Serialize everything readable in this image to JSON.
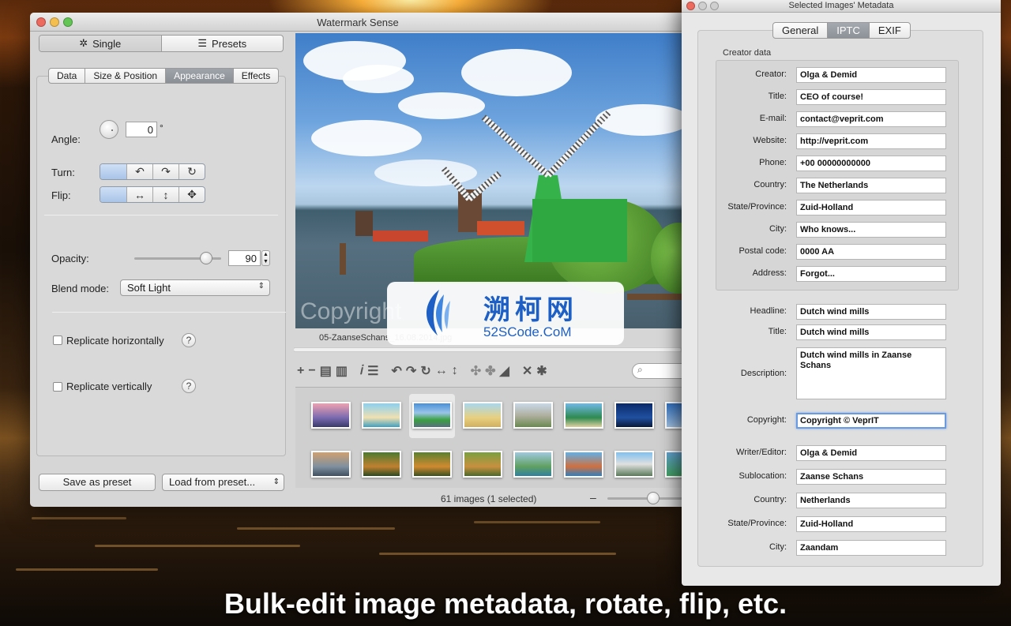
{
  "main_window": {
    "title": "Watermark Sense",
    "top_segments": [
      {
        "icon": "gear-icon",
        "label": "Single"
      },
      {
        "icon": "list-icon",
        "label": "Presets"
      }
    ],
    "tabs": [
      "Data",
      "Size & Position",
      "Appearance",
      "Effects"
    ],
    "selected_tab": "Appearance",
    "angle": {
      "label": "Angle:",
      "value": "0",
      "unit": "°"
    },
    "turn": {
      "label": "Turn:",
      "icons": [
        "none",
        "rotate-left-icon",
        "rotate-right-icon",
        "rotate-redo-icon"
      ]
    },
    "flip": {
      "label": "Flip:",
      "icons": [
        "none",
        "flip-horizontal-icon",
        "flip-vertical-icon",
        "flip-both-icon"
      ]
    },
    "opacity": {
      "label": "Opacity:",
      "value": "90",
      "level": 0.9
    },
    "blend_mode": {
      "label": "Blend mode:",
      "value": "Soft Light"
    },
    "replicate_h": "Replicate horizontally",
    "replicate_v": "Replicate vertically",
    "help_glyph": "?",
    "save_preset": "Save as preset",
    "load_preset": "Load from preset...",
    "preview_watermark": "Copyright",
    "filename": "05-ZaanseSchans_16.08.2014.jpg",
    "status": "61 images (1 selected)",
    "zoom_minus": "–",
    "zoom_level": 0.58
  },
  "metadata_window": {
    "title": "Selected Images' Metadata",
    "tabs": [
      "General",
      "IPTC",
      "EXIF"
    ],
    "selected_tab": "IPTC",
    "group_title": "Creator data",
    "creator_fields": [
      {
        "label": "Creator:",
        "value": "Olga & Demid"
      },
      {
        "label": "Title:",
        "value": "CEO of course!"
      },
      {
        "label": "E-mail:",
        "value": "contact@veprit.com"
      },
      {
        "label": "Website:",
        "value": "http://veprit.com"
      },
      {
        "label": "Phone:",
        "value": "+00 00000000000"
      },
      {
        "label": "Country:",
        "value": "The Netherlands"
      },
      {
        "label": "State/Province:",
        "value": "Zuid-Holland"
      },
      {
        "label": "City:",
        "value": "Who knows..."
      },
      {
        "label": "Postal code:",
        "value": "0000 AA"
      },
      {
        "label": "Address:",
        "value": "Forgot..."
      }
    ],
    "headline": {
      "label": "Headline:",
      "value": "Dutch wind mills"
    },
    "title_field": {
      "label": "Title:",
      "value": "Dutch wind mills"
    },
    "description": {
      "label": "Description:",
      "value": "Dutch wind mills in Zaanse Schans"
    },
    "copyright": {
      "label": "Copyright:",
      "value": "Copyright © VeprIT"
    },
    "bottom_fields": [
      {
        "label": "Writer/Editor:",
        "value": "Olga & Demid"
      },
      {
        "label": "Sublocation:",
        "value": "Zaanse Schans"
      },
      {
        "label": "Country:",
        "value": "Netherlands"
      },
      {
        "label": "State/Province:",
        "value": "Zuid-Holland"
      },
      {
        "label": "City:",
        "value": "Zaandam"
      }
    ]
  },
  "overlay": {
    "name_cn": "溯柯网",
    "name_en": "52SCode.CoM"
  },
  "caption": "Bulk-edit image metadata, rotate, flip, etc.",
  "colors": {
    "accent_selected": "#8d9298",
    "focus_ring": "#6a9be0",
    "logo_blue": "#1d5fc4"
  }
}
